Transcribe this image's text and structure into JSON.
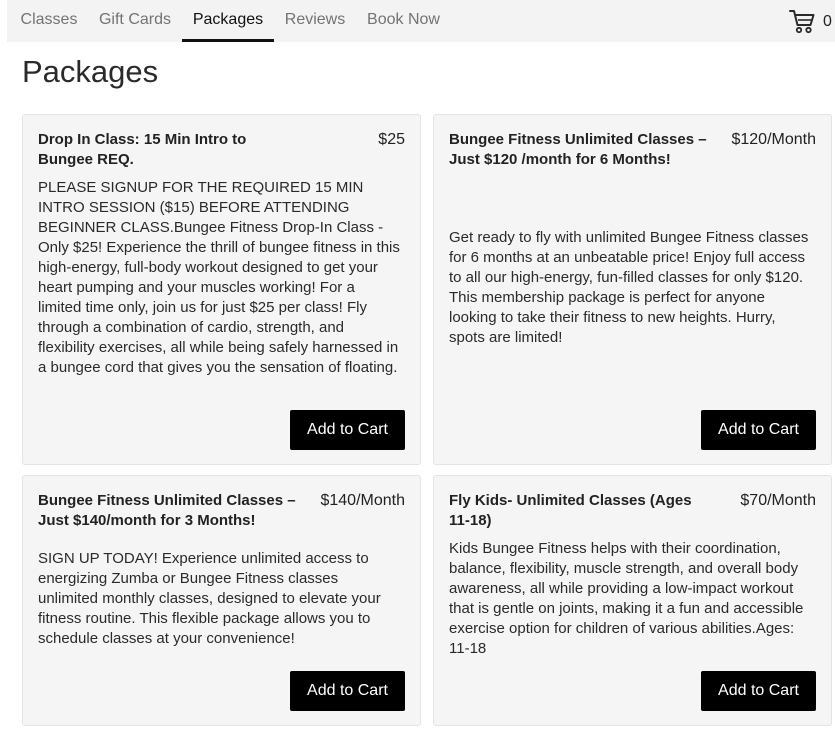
{
  "nav": {
    "tabs": [
      {
        "label": "Classes"
      },
      {
        "label": "Gift Cards"
      },
      {
        "label": "Packages"
      },
      {
        "label": "Reviews"
      },
      {
        "label": "Book Now"
      }
    ],
    "active_tab": "Packages",
    "cart": {
      "icon": "cart-icon",
      "count": "0"
    }
  },
  "page": {
    "title": "Packages"
  },
  "packages": [
    {
      "name": "Drop In Class: 15 Min Intro to Bungee REQ.",
      "price": "$25",
      "description": "PLEASE SIGNUP FOR THE REQUIRED 15 MIN INTRO SESSION ($15) BEFORE ATTENDING BEGINNER CLASS.Bungee Fitness Drop-In Class - Only $25! Experience the thrill of bungee fitness in this high-energy, full-body workout designed to get your heart pumping and your muscles working! For a limited time only, join us for just $25 per class! Fly through a combination of cardio, strength, and flexibility exercises, all while being safely harnessed in a bungee cord that gives you the sensation of floating.",
      "button_label": "Add to Cart"
    },
    {
      "name": "Bungee Fitness Unlimited Classes – Just $120 /month for 6 Months!",
      "price": "$120/Month",
      "description": "Get ready to fly with unlimited Bungee Fitness classes for 6 months at an unbeatable price! Enjoy full access to all our high-energy, fun-filled classes for only $120. This membership package is perfect for anyone looking to take their fitness to new heights. Hurry, spots are limited!",
      "button_label": "Add to Cart"
    },
    {
      "name": "Bungee Fitness Unlimited Classes – Just $140/month for 3 Months!",
      "price": "$140/Month",
      "description": "SIGN UP TODAY! Experience unlimited access to energizing Zumba or Bungee Fitness classes unlimited monthly classes, designed to elevate your fitness routine. This flexible package allows you to schedule classes at your convenience!",
      "button_label": "Add to Cart"
    },
    {
      "name": "Fly Kids- Unlimited Classes (Ages 11-18)",
      "price": "$70/Month",
      "description": "Kids Bungee Fitness helps with their coordination, balance, flexibility, muscle strength, and overall body awareness, all while providing a low-impact workout that is gentle on joints, making it a fun and accessible exercise option for children of various abilities.Ages: 11-18",
      "button_label": "Add to Cart"
    }
  ]
}
